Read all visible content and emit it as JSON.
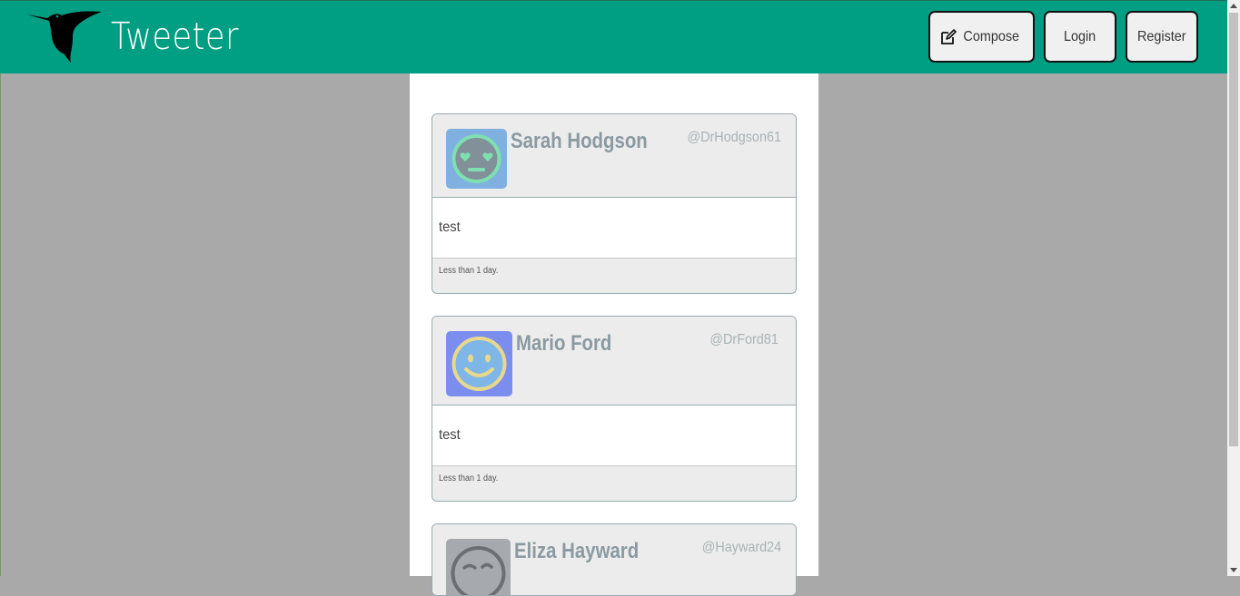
{
  "app": {
    "brand": "Tweeter"
  },
  "nav": {
    "compose_label": "Compose",
    "login_label": "Login",
    "register_label": "Register"
  },
  "tweets": [
    {
      "name": "Sarah Hodgson",
      "handle": "@DrHodgson61",
      "text": "test",
      "time": "Less than 1 day.",
      "avatar": "heart-eyes-face-icon",
      "avatar_bg": "#7fb0e0"
    },
    {
      "name": "Mario Ford",
      "handle": "@DrFord81",
      "text": "test",
      "time": "Less than 1 day.",
      "avatar": "smiley-face-icon",
      "avatar_bg": "#7b8ef0"
    },
    {
      "name": "Eliza Hayward",
      "handle": "@Hayward24",
      "avatar": "winking-face-icon",
      "avatar_bg": "#a6a9ad"
    }
  ],
  "colors": {
    "navbar": "#009e82",
    "page_bg": "#a9a9a9"
  }
}
